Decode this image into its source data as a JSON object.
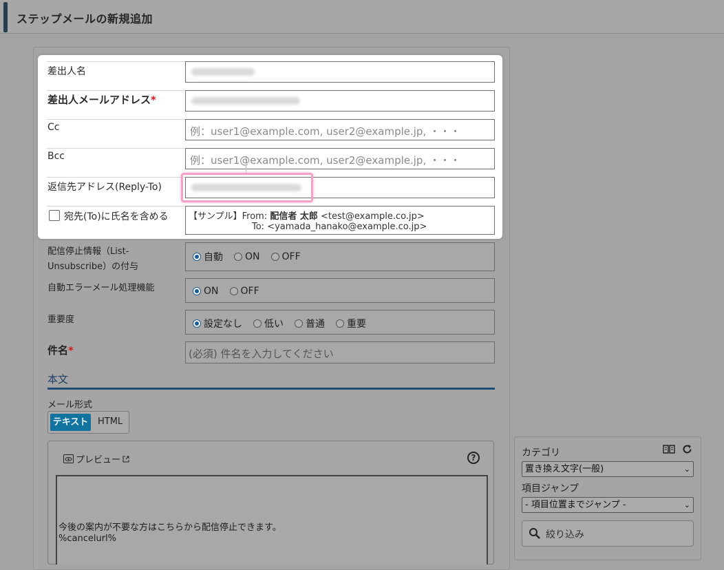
{
  "header": {
    "title": "ステップメールの新規追加"
  },
  "panel": {
    "sender_name": {
      "label": "差出人名"
    },
    "sender_email": {
      "label": "差出人メールアドレス",
      "required_mark": "*"
    },
    "cc": {
      "label": "Cc",
      "placeholder": "例：user1@example.com, user2@example.jp, ・・・"
    },
    "bcc": {
      "label": "Bcc",
      "placeholder": "例：user1@example.com, user2@example.jp, ・・・"
    },
    "reply_to": {
      "label": "返信先アドレス(Reply-To)"
    },
    "include_name": {
      "label": "宛先(To)に氏名を含める",
      "checked": false,
      "sample_prefix": "【サンプル】From:",
      "sample_from_name": "配信者 太郎",
      "sample_from_addr": "<test@example.co.jp>",
      "sample_to": "To: <yamada_hanako@example.co.jp>"
    }
  },
  "list_unsubscribe": {
    "label_line1": "配信停止情報（List-",
    "label_line2": "Unsubscribe）の付与",
    "options": [
      "自動",
      "ON",
      "OFF"
    ],
    "selected": "自動"
  },
  "auto_error": {
    "label": "自動エラーメール処理機能",
    "options": [
      "ON",
      "OFF"
    ],
    "selected": "ON"
  },
  "importance": {
    "label": "重要度",
    "options": [
      "設定なし",
      "低い",
      "普通",
      "重要"
    ],
    "selected": "設定なし"
  },
  "subject": {
    "label": "件名",
    "required_mark": "*",
    "placeholder": "(必須) 件名を入力してください"
  },
  "body": {
    "section_title": "本文",
    "format_label": "メール形式",
    "format_options": [
      "テキスト",
      "HTML"
    ],
    "format_selected": "テキスト",
    "preview_label": "プレビュー",
    "help_glyph": "?",
    "text_lines": [
      "今後の案内が不要な方はこちらから配信停止できます。",
      "%cancelurl%"
    ]
  },
  "side_panel": {
    "category_label": "カテゴリ",
    "category_value": "置き換え文字(一般)",
    "jump_label": "項目ジャンプ",
    "jump_value": "- 項目位置までジャンプ -",
    "filter_placeholder": "絞り込み",
    "icons": [
      "dictionary-icon",
      "refresh-icon",
      "search-icon"
    ]
  },
  "colors": {
    "accent": "#1a5a91",
    "highlight_border": "#f5a0c6",
    "required": "#d21c1c",
    "brand_dark": "#2b3e4f"
  }
}
